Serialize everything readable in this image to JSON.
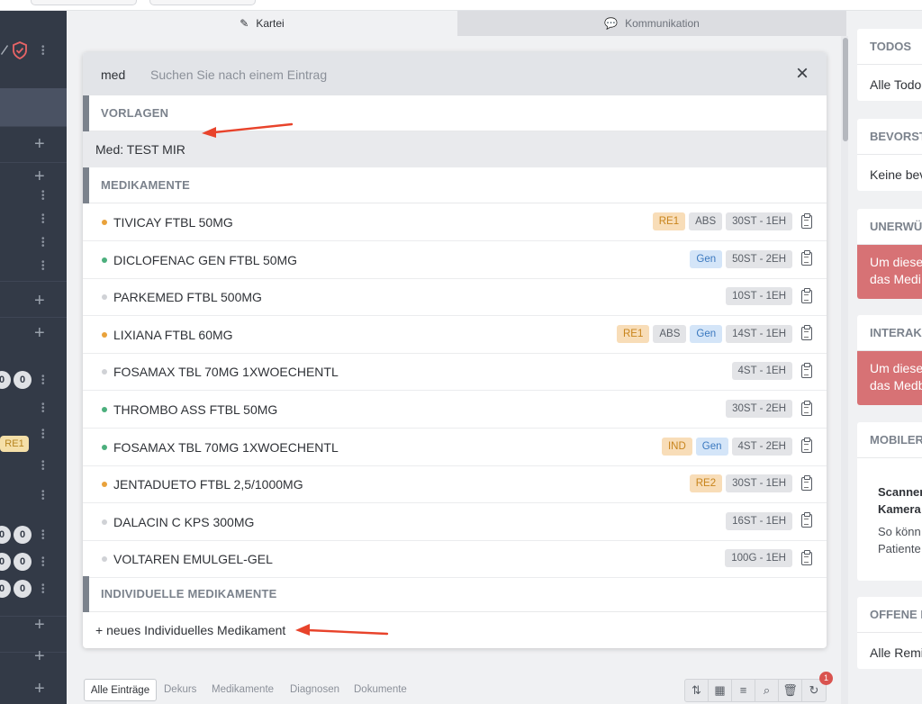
{
  "tabs": {
    "kartei": "Kartei",
    "kommunikation": "Kommunikation"
  },
  "sidebar": {
    "counts": [
      "0",
      "0",
      "0",
      "0",
      "0",
      "0",
      "0"
    ],
    "badge": "RE1"
  },
  "search": {
    "query": "med",
    "placeholder": "Suchen Sie nach einem Eintrag"
  },
  "sections": {
    "vorlagen": "VORLAGEN",
    "medikamente": "MEDIKAMENTE",
    "individuelle": "INDIVIDUELLE MEDIKAMENTE"
  },
  "template_item": "Med: TEST MIR",
  "medications": [
    {
      "name": "TIVICAY FTBL 50MG",
      "dot": "#e9a23b",
      "tags": [
        {
          "t": "RE1",
          "c": "re"
        },
        {
          "t": "ABS",
          "c": "abs"
        }
      ],
      "pack": "30ST - 1EH"
    },
    {
      "name": "DICLOFENAC GEN FTBL 50MG",
      "dot": "#4caf7d",
      "tags": [
        {
          "t": "Gen",
          "c": "gen"
        }
      ],
      "pack": "50ST - 2EH"
    },
    {
      "name": "PARKEMED FTBL 500MG",
      "dot": "#d0d2d6",
      "tags": [],
      "pack": "10ST - 1EH"
    },
    {
      "name": "LIXIANA FTBL 60MG",
      "dot": "#e9a23b",
      "tags": [
        {
          "t": "RE1",
          "c": "re"
        },
        {
          "t": "ABS",
          "c": "abs"
        },
        {
          "t": "Gen",
          "c": "gen"
        }
      ],
      "pack": "14ST - 1EH"
    },
    {
      "name": "FOSAMAX TBL 70MG 1XWOECHENTL",
      "dot": "#d0d2d6",
      "tags": [],
      "pack": "4ST - 1EH"
    },
    {
      "name": "THROMBO ASS FTBL 50MG",
      "dot": "#4caf7d",
      "tags": [],
      "pack": "30ST - 2EH"
    },
    {
      "name": "FOSAMAX TBL 70MG 1XWOECHENTL",
      "dot": "#4caf7d",
      "tags": [
        {
          "t": "IND",
          "c": "ind"
        },
        {
          "t": "Gen",
          "c": "gen"
        }
      ],
      "pack": "4ST - 2EH"
    },
    {
      "name": "JENTADUETO FTBL 2,5/1000MG",
      "dot": "#e9a23b",
      "tags": [
        {
          "t": "RE2",
          "c": "re"
        }
      ],
      "pack": "30ST - 1EH"
    },
    {
      "name": "DALACIN C KPS 300MG",
      "dot": "#d0d2d6",
      "tags": [],
      "pack": "16ST - 1EH"
    },
    {
      "name": "VOLTAREN EMULGEL-GEL",
      "dot": "#d0d2d6",
      "tags": [],
      "pack": "100G - 1EH"
    }
  ],
  "new_item": "+ neues Individuelles Medikament",
  "filters": [
    "Alle Einträge",
    "Dekurs",
    "Medikamente",
    "Diagnosen",
    "Dokumente"
  ],
  "toolbar_icons": [
    "sort-icon",
    "table-icon",
    "sliders-icon",
    "search-icon",
    "trash-icon",
    "refresh-icon"
  ],
  "notification_count": "1",
  "right_panel": {
    "todos_title": "TODOS",
    "todos_body": "Alle Todo",
    "bevorst_title": "BEVORST",
    "bevorst_body": "Keine bev",
    "unerw_title": "UNERWÜ",
    "unerw_line1": "Um diese",
    "unerw_line2": "das Medi",
    "interak_title": "INTERAK",
    "interak_line1": "Um diese",
    "interak_line2": "das Medb",
    "mobile_title": "MOBILER",
    "mobile_bold1": "Scanner",
    "mobile_bold2": "Kamera",
    "mobile_text1": "So könn",
    "mobile_text2": "Patiente",
    "offene_title": "OFFENE F",
    "offene_body": "Alle Remi"
  },
  "colors": {
    "sidebar": "#333a47",
    "accent_red": "#d77275",
    "annotation_arrow": "#e8432b"
  }
}
